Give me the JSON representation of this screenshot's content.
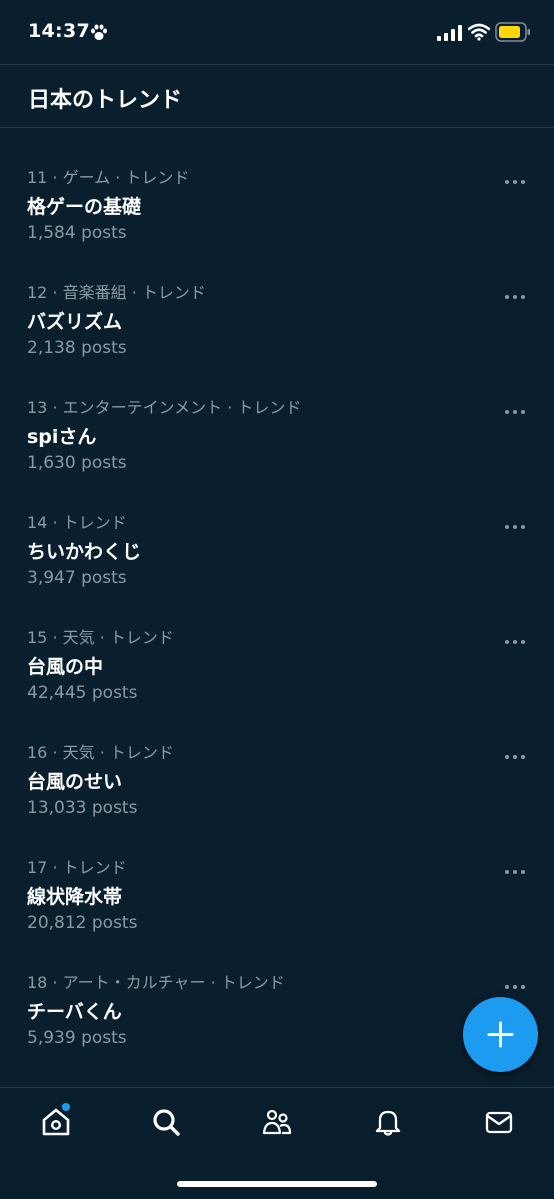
{
  "status_bar": {
    "time": "14:37",
    "icons": [
      "paw-icon",
      "signal-icon",
      "wifi-icon",
      "battery-icon"
    ],
    "battery_color": "#ffd60a"
  },
  "header": {
    "title": "日本のトレンド"
  },
  "trends": [
    {
      "meta": "11 · ゲーム · トレンド",
      "title": "格ゲーの基礎",
      "posts": "1,584 posts"
    },
    {
      "meta": "12 · 音楽番組 · トレンド",
      "title": "バズリズム",
      "posts": "2,138 posts"
    },
    {
      "meta": "13 · エンターテインメント · トレンド",
      "title": "spiさん",
      "posts": "1,630 posts"
    },
    {
      "meta": "14 · トレンド",
      "title": "ちいかわくじ",
      "posts": "3,947 posts"
    },
    {
      "meta": "15 · 天気 · トレンド",
      "title": "台風の中",
      "posts": "42,445 posts"
    },
    {
      "meta": "16 · 天気 · トレンド",
      "title": "台風のせい",
      "posts": "13,033 posts"
    },
    {
      "meta": "17 · トレンド",
      "title": "線状降水帯",
      "posts": "20,812 posts"
    },
    {
      "meta": "18 · アート・カルチャー · トレンド",
      "title": "チーバくん",
      "posts": "5,939 posts"
    }
  ],
  "fab": {
    "icon": "plus-icon",
    "color": "#1d9bf0"
  },
  "bottom_nav": {
    "items": [
      {
        "name": "home",
        "icon": "home-icon",
        "active": true,
        "has_notification_dot": true
      },
      {
        "name": "search",
        "icon": "search-icon",
        "active": false
      },
      {
        "name": "communities",
        "icon": "communities-icon",
        "active": false
      },
      {
        "name": "notifications",
        "icon": "bell-icon",
        "active": false
      },
      {
        "name": "messages",
        "icon": "mail-icon",
        "active": false
      }
    ]
  },
  "colors": {
    "background": "#0a1f2e",
    "text_primary": "#ffffff",
    "text_secondary": "#8b98a5",
    "accent": "#1d9bf0",
    "divider": "#23394a"
  }
}
